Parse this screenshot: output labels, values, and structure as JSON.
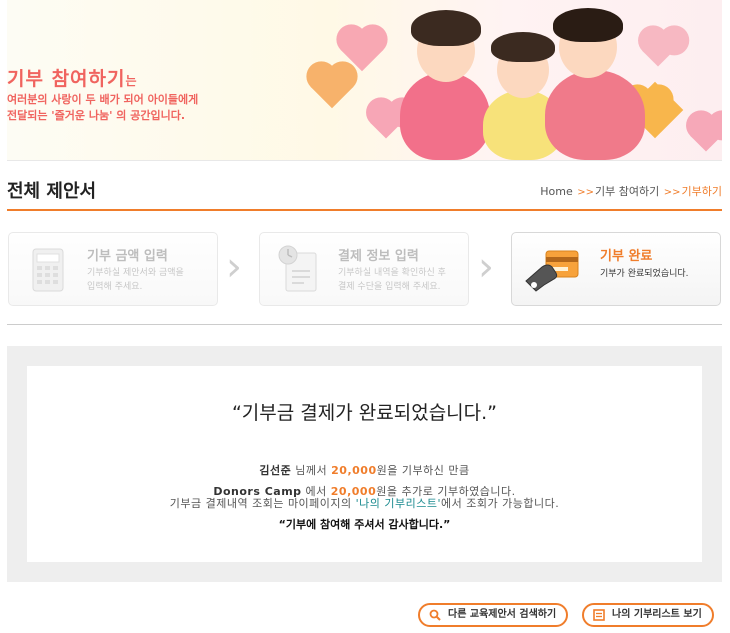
{
  "banner": {
    "title": "기부 참여하기",
    "title_suffix": "는",
    "desc_line1": "여러분의 사랑이 두 배가 되어 아이들에게",
    "desc_line2": "전달되는 '즐거운 나눔' 의 공간입니다."
  },
  "page": {
    "title": "전체 제안서",
    "breadcrumb": [
      "Home",
      "기부 참여하기",
      "기부하기"
    ],
    "breadcrumb_sep": "›"
  },
  "steps": [
    {
      "title": "기부 금액 입력",
      "desc1": "기부하실 제안서와 금액을",
      "desc2": "입력해 주세요.",
      "icon": "calculator-icon",
      "state": "inactive"
    },
    {
      "title": "결제 정보 입력",
      "desc1": "기부하실 내역을 확인하신 후",
      "desc2": "결제 수단을 입력해 주세요.",
      "icon": "clock-document-icon",
      "state": "inactive"
    },
    {
      "title": "기부 완료",
      "desc1": "기부가 완료되었습니다.",
      "desc2": "",
      "icon": "card-hand-icon",
      "state": "active"
    }
  ],
  "result": {
    "headline": "“기부금 결제가 완료되었습니다.”",
    "line1_name": "김선준",
    "line1_a": " 님께서 ",
    "line1_amount": "20,000",
    "line1_b": "원을 기부하신 만큼",
    "line2_org": "Donors Camp",
    "line2_a": " 에서 ",
    "line2_amount": "20,000",
    "line2_b": "원을 추가로 기부하였습니다.",
    "line3_a": "기부금 결제내역 조회는 마이페이지의 ",
    "line3_link": "'나의 기부리스트'",
    "line3_b": "에서 조회가 가능합니다.",
    "thanks": "“기부에 참여해 주셔서 감사합니다.”"
  },
  "buttons": {
    "search": "다른 교육제안서 검색하기",
    "list": "나의 기부리스트 보기"
  },
  "colors": {
    "accent": "#f07d2b",
    "banner_text": "#f0645f",
    "link": "#1a8a8f"
  }
}
